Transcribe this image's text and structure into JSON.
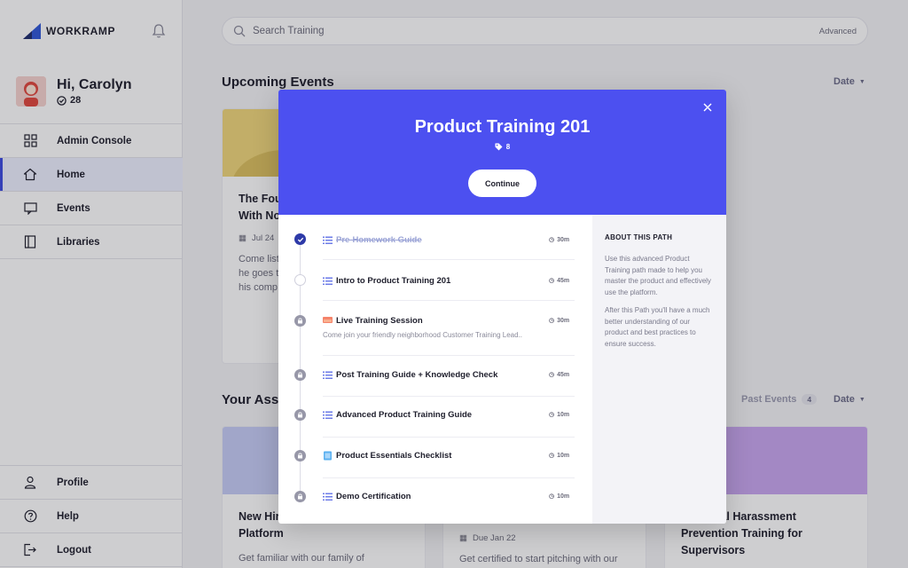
{
  "app": {
    "logo_text": "WORKRAMP"
  },
  "user": {
    "greeting": "Hi, Carolyn",
    "badge_count": "28"
  },
  "sidebar": {
    "top_items": [
      {
        "label": "Admin Console",
        "icon": "grid-icon"
      },
      {
        "label": "Home",
        "icon": "home-icon",
        "active": true
      },
      {
        "label": "Events",
        "icon": "events-icon"
      },
      {
        "label": "Libraries",
        "icon": "libraries-icon"
      }
    ],
    "bottom_items": [
      {
        "label": "Profile",
        "icon": "profile-icon"
      },
      {
        "label": "Help",
        "icon": "help-icon"
      },
      {
        "label": "Logout",
        "icon": "logout-icon"
      }
    ]
  },
  "search": {
    "placeholder": "Search Training",
    "advanced_label": "Advanced"
  },
  "upcoming": {
    "title": "Upcoming Events",
    "sort_label": "Date",
    "card": {
      "title_line1": "The Fou",
      "title_line2": "With No",
      "date": "Jul 24",
      "desc_line1": "Come list",
      "desc_line2": "he goes t",
      "desc_line3": "his comp"
    }
  },
  "assignments": {
    "title": "Your Assi",
    "past_events_label": "Past Events",
    "past_events_count": "4",
    "sort_label": "Date",
    "cards": [
      {
        "title_line1": "New Hir",
        "title_line2": "Platform",
        "desc": "Get familiar with our family of"
      },
      {
        "date": "Due Jan 22",
        "desc": "Get certified to start pitching with our"
      },
      {
        "title_line1": "a: Sexual Harassment",
        "title_line2": "Prevention Training for",
        "title_line3": "Supervisors"
      }
    ]
  },
  "modal": {
    "title": "Product Training 201",
    "tag_count": "8",
    "continue_label": "Continue",
    "about": {
      "title": "ABOUT THIS PATH",
      "p1": "Use this advanced Product Training path made to help you master the product and effectively use the platform.",
      "p2": "After this Path you'll have a much better understanding of our product and best practices to ensure success."
    },
    "steps": [
      {
        "title": "Pre-Homework Guide",
        "duration": "30m",
        "status": "done",
        "type": "guide"
      },
      {
        "title": "Intro to Product Training 201",
        "duration": "45m",
        "status": "open",
        "type": "guide"
      },
      {
        "title": "Live Training Session",
        "duration": "30m",
        "status": "locked",
        "type": "event",
        "desc": "Come join your friendly neighborhood Customer Training Lead.."
      },
      {
        "title": "Post Training Guide + Knowledge Check",
        "duration": "45m",
        "status": "locked",
        "type": "guide"
      },
      {
        "title": "Advanced Product Training Guide",
        "duration": "10m",
        "status": "locked",
        "type": "guide"
      },
      {
        "title": "Product Essentials Checklist",
        "duration": "10m",
        "status": "locked",
        "type": "checklist"
      },
      {
        "title": "Demo Certification",
        "duration": "10m",
        "status": "locked",
        "type": "guide"
      }
    ]
  },
  "colors": {
    "accent": "#4c50f0",
    "done": "#2e3aa8",
    "locked": "#9797a8"
  }
}
